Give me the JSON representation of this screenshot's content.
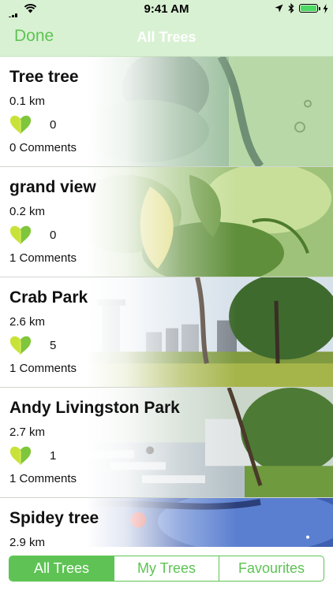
{
  "status_bar": {
    "time": "9:41 AM"
  },
  "nav": {
    "done_label": "Done",
    "title": "All Trees"
  },
  "trees": [
    {
      "name": "Tree tree",
      "distance": "0.1 km",
      "likes": "0",
      "comments": "0 Comments"
    },
    {
      "name": "grand view",
      "distance": "0.2 km",
      "likes": "0",
      "comments": "1 Comments"
    },
    {
      "name": "Crab Park",
      "distance": "2.6 km",
      "likes": "5",
      "comments": "1 Comments"
    },
    {
      "name": "Andy Livingston Park",
      "distance": "2.7 km",
      "likes": "1",
      "comments": "1 Comments"
    },
    {
      "name": "Spidey tree",
      "distance": "2.9 km",
      "likes": "",
      "comments": ""
    }
  ],
  "tabs": [
    "All Trees",
    "My Trees",
    "Favourites"
  ],
  "colors": {
    "accent": "#5ec354",
    "header_bg": "#d9f1d3"
  }
}
